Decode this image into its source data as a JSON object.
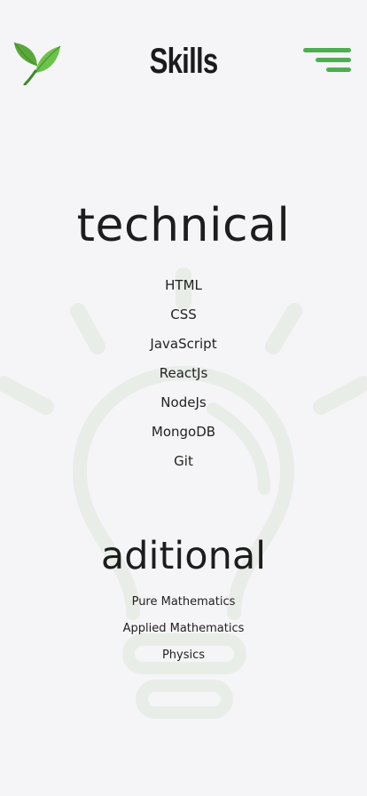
{
  "header": {
    "title": "Skills",
    "logo_icon": "leaf-icon",
    "menu_icon": "hamburger-menu-icon",
    "accent_color": "#4caf50"
  },
  "background": {
    "icon": "lightbulb-icon",
    "color": "#e9eee9"
  },
  "technical": {
    "title": "technical",
    "items": [
      "HTML",
      "CSS",
      "JavaScript",
      "ReactJs",
      "NodeJs",
      "MongoDB",
      "Git"
    ]
  },
  "additional": {
    "title": "aditional",
    "items": [
      "Pure Mathematics",
      "Applied Mathematics",
      "Physics"
    ]
  }
}
